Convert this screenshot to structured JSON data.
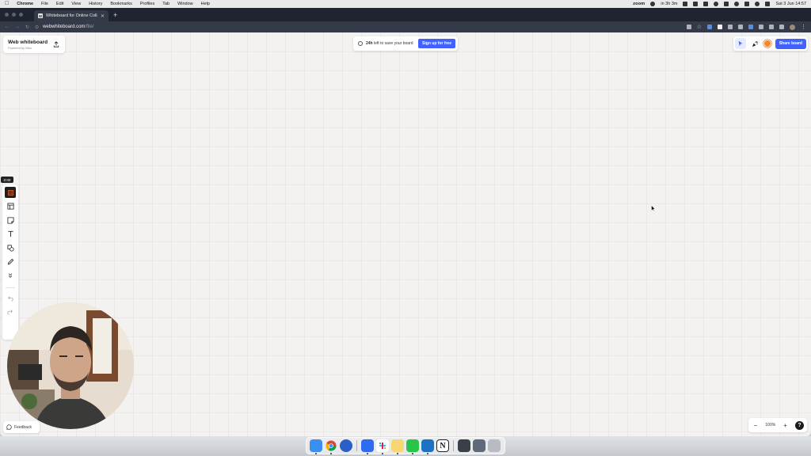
{
  "menubar": {
    "app_name": "Chrome",
    "items": [
      "File",
      "Edit",
      "View",
      "History",
      "Bookmarks",
      "Profiles",
      "Tab",
      "Window",
      "Help"
    ],
    "zoom_label": "zoom",
    "timer": "in 3h 3m",
    "datetime": "Sat 3 Jun  14:57"
  },
  "browser": {
    "tab_title": "Whiteboard for Online Collab...",
    "tab_favicon": "W",
    "url_domain": "webwhiteboard.com",
    "url_path": "/file/"
  },
  "board": {
    "title": "Web whiteboard",
    "subtitle": "Powered by Miro"
  },
  "banner": {
    "time_bold": "24h",
    "text": " left to save your board",
    "signup_label": "Sign up for free"
  },
  "top_right": {
    "share_label": "Share board"
  },
  "left_toolbar": {
    "timer_badge": "0:00",
    "tools": [
      "frames-icon",
      "templates-icon",
      "sticky-note-icon",
      "text-icon",
      "shapes-icon",
      "pen-icon",
      "more-icon"
    ]
  },
  "feedback": {
    "label": "Feedback"
  },
  "zoom": {
    "minus": "−",
    "level": "100%",
    "plus": "+",
    "help": "?"
  },
  "colors": {
    "accent": "#4262ff",
    "canvas": "#f3f2f1",
    "browser_dark": "#1f2430"
  }
}
